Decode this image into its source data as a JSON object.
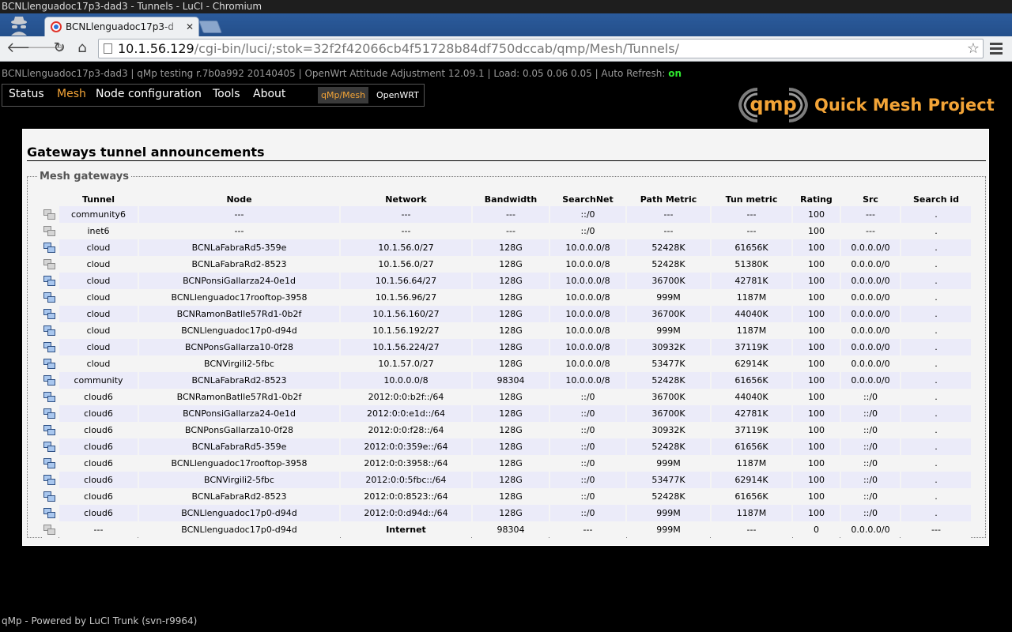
{
  "window": {
    "title": "BCNLlenguadoc17p3-dad3 - Tunnels - LuCI - Chromium"
  },
  "tab": {
    "title": "BCNLlenguadoc17p3-d"
  },
  "omnibox": {
    "host": "10.1.56.129",
    "path": "/cgi-bin/luci/;stok=32f2f42066cb4f51728b84df750dccab/qmp/Mesh/Tunnels/"
  },
  "status": {
    "text": "BCNLlenguadoc17p3-dad3 | qMp testing r.7b0a992 20140405 | OpenWrt Attitude Adjustment 12.09.1 | Load: 0.05 0.06 0.05 | Auto Refresh: ",
    "refresh": "on"
  },
  "nav": {
    "items": [
      "Status",
      "Mesh",
      "Node configuration",
      "Tools",
      "About"
    ],
    "active": "Mesh"
  },
  "subnav": {
    "items": [
      "qMp/Mesh",
      "OpenWRT"
    ]
  },
  "brand": {
    "logo": "qmp",
    "name": "Quick Mesh Project",
    "accent": "#f3a437"
  },
  "section": {
    "title": "Gateways tunnel announcements",
    "legend": "Mesh gateways"
  },
  "table": {
    "headers": [
      "Tunnel",
      "Node",
      "Network",
      "Bandwidth",
      "SearchNet",
      "Path Metric",
      "Tun metric",
      "Rating",
      "Src",
      "Search id"
    ],
    "rows": [
      {
        "icon": "grey",
        "cells": [
          "community6",
          "---",
          "---",
          "---",
          "::/0",
          "---",
          "---",
          "100",
          "---",
          "."
        ]
      },
      {
        "icon": "grey",
        "cells": [
          "inet6",
          "---",
          "---",
          "---",
          "::/0",
          "---",
          "---",
          "100",
          "---",
          "."
        ]
      },
      {
        "icon": "blue",
        "cells": [
          "cloud",
          "BCNLaFabraRd5-359e",
          "10.1.56.0/27",
          "128G",
          "10.0.0.0/8",
          "52428K",
          "61656K",
          "100",
          "0.0.0.0/0",
          "."
        ]
      },
      {
        "icon": "grey",
        "cells": [
          "cloud",
          "BCNLaFabraRd2-8523",
          "10.1.56.0/27",
          "128G",
          "10.0.0.0/8",
          "52428K",
          "51380K",
          "100",
          "0.0.0.0/0",
          "."
        ]
      },
      {
        "icon": "blue",
        "cells": [
          "cloud",
          "BCNPonsiGallarza24-0e1d",
          "10.1.56.64/27",
          "128G",
          "10.0.0.0/8",
          "36700K",
          "42781K",
          "100",
          "0.0.0.0/0",
          "."
        ]
      },
      {
        "icon": "blue",
        "cells": [
          "cloud",
          "BCNLlenguadoc17rooftop-3958",
          "10.1.56.96/27",
          "128G",
          "10.0.0.0/8",
          "999M",
          "1187M",
          "100",
          "0.0.0.0/0",
          "."
        ]
      },
      {
        "icon": "blue",
        "cells": [
          "cloud",
          "BCNRamonBatlle57Rd1-0b2f",
          "10.1.56.160/27",
          "128G",
          "10.0.0.0/8",
          "36700K",
          "44040K",
          "100",
          "0.0.0.0/0",
          "."
        ]
      },
      {
        "icon": "blue",
        "cells": [
          "cloud",
          "BCNLlenguadoc17p0-d94d",
          "10.1.56.192/27",
          "128G",
          "10.0.0.0/8",
          "999M",
          "1187M",
          "100",
          "0.0.0.0/0",
          "."
        ]
      },
      {
        "icon": "blue",
        "cells": [
          "cloud",
          "BCNPonsGallarza10-0f28",
          "10.1.56.224/27",
          "128G",
          "10.0.0.0/8",
          "30932K",
          "37119K",
          "100",
          "0.0.0.0/0",
          "."
        ]
      },
      {
        "icon": "blue",
        "cells": [
          "cloud",
          "BCNVirgili2-5fbc",
          "10.1.57.0/27",
          "128G",
          "10.0.0.0/8",
          "53477K",
          "62914K",
          "100",
          "0.0.0.0/0",
          "."
        ]
      },
      {
        "icon": "blue",
        "cells": [
          "community",
          "BCNLaFabraRd2-8523",
          "10.0.0.0/8",
          "98304",
          "10.0.0.0/8",
          "52428K",
          "61656K",
          "100",
          "0.0.0.0/0",
          "."
        ]
      },
      {
        "icon": "blue",
        "cells": [
          "cloud6",
          "BCNRamonBatlle57Rd1-0b2f",
          "2012:0:0:b2f::/64",
          "128G",
          "::/0",
          "36700K",
          "44040K",
          "100",
          "::/0",
          "."
        ]
      },
      {
        "icon": "blue",
        "cells": [
          "cloud6",
          "BCNPonsiGallarza24-0e1d",
          "2012:0:0:e1d::/64",
          "128G",
          "::/0",
          "36700K",
          "42781K",
          "100",
          "::/0",
          "."
        ]
      },
      {
        "icon": "blue",
        "cells": [
          "cloud6",
          "BCNPonsGallarza10-0f28",
          "2012:0:0:f28::/64",
          "128G",
          "::/0",
          "30932K",
          "37119K",
          "100",
          "::/0",
          "."
        ]
      },
      {
        "icon": "blue",
        "cells": [
          "cloud6",
          "BCNLaFabraRd5-359e",
          "2012:0:0:359e::/64",
          "128G",
          "::/0",
          "52428K",
          "61656K",
          "100",
          "::/0",
          "."
        ]
      },
      {
        "icon": "blue",
        "cells": [
          "cloud6",
          "BCNLlenguadoc17rooftop-3958",
          "2012:0:0:3958::/64",
          "128G",
          "::/0",
          "999M",
          "1187M",
          "100",
          "::/0",
          "."
        ]
      },
      {
        "icon": "blue",
        "cells": [
          "cloud6",
          "BCNVirgili2-5fbc",
          "2012:0:0:5fbc::/64",
          "128G",
          "::/0",
          "53477K",
          "62914K",
          "100",
          "::/0",
          "."
        ]
      },
      {
        "icon": "blue",
        "cells": [
          "cloud6",
          "BCNLaFabraRd2-8523",
          "2012:0:0:8523::/64",
          "128G",
          "::/0",
          "52428K",
          "61656K",
          "100",
          "::/0",
          "."
        ]
      },
      {
        "icon": "blue",
        "cells": [
          "cloud6",
          "BCNLlenguadoc17p0-d94d",
          "2012:0:0:d94d::/64",
          "128G",
          "::/0",
          "999M",
          "1187M",
          "100",
          "::/0",
          "."
        ]
      },
      {
        "icon": "grey",
        "bold_network": true,
        "cells": [
          "---",
          "BCNLlenguadoc17p0-d94d",
          "Internet",
          "98304",
          "---",
          "999M",
          "---",
          "0",
          "0.0.0.0/0",
          "---"
        ]
      }
    ]
  },
  "footer": {
    "text": "qMp - Powered by LuCI Trunk (svn-r9964)"
  }
}
